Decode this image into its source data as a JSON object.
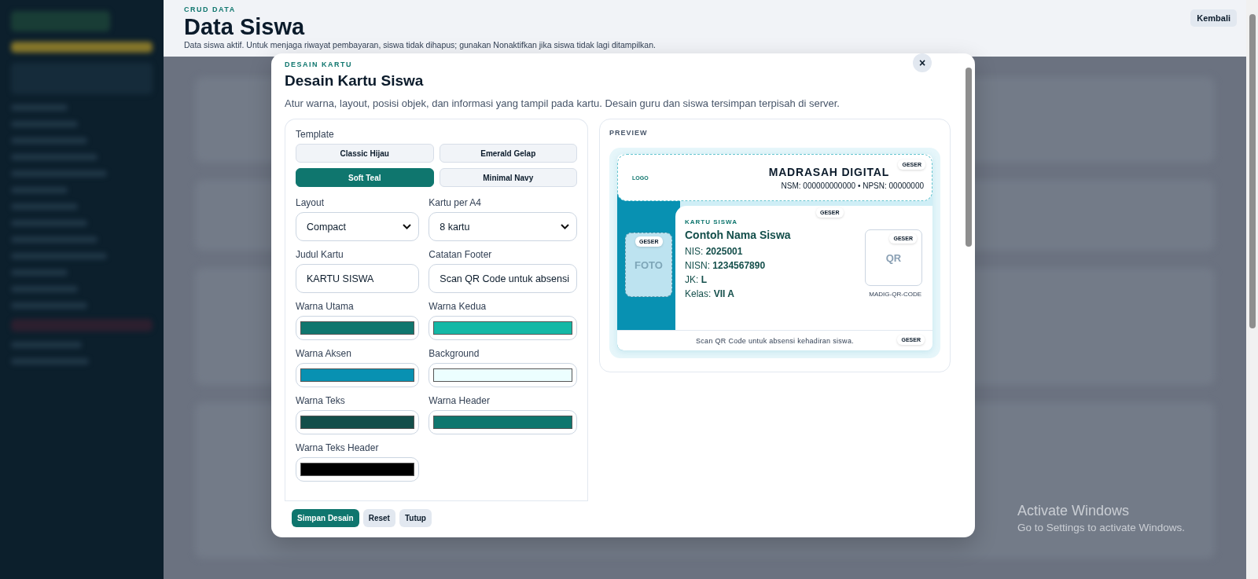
{
  "header": {
    "eyebrow": "CRUD DATA",
    "title": "Data Siswa",
    "description": "Data siswa aktif. Untuk menjaga riwayat pembayaran, siswa tidak dihapus; gunakan Nonaktifkan jika siswa tidak lagi ditampilkan.",
    "back_button": "Kembali"
  },
  "modal": {
    "eyebrow": "DESAIN KARTU",
    "title": "Desain Kartu Siswa",
    "description": "Atur warna, layout, posisi objek, dan informasi yang tampil pada kartu. Desain guru dan siswa tersimpan terpisah di server.",
    "close_label": "×",
    "template_label": "Template",
    "templates": [
      {
        "label": "Classic Hijau",
        "selected": false
      },
      {
        "label": "Emerald Gelap",
        "selected": false
      },
      {
        "label": "Soft Teal",
        "selected": true
      },
      {
        "label": "Minimal Navy",
        "selected": false
      }
    ],
    "fields": [
      {
        "kind": "select",
        "label": "Layout",
        "value": "Compact"
      },
      {
        "kind": "select",
        "label": "Kartu per A4",
        "value": "8 kartu"
      },
      {
        "kind": "text",
        "label": "Judul Kartu",
        "value": "KARTU SISWA"
      },
      {
        "kind": "text",
        "label": "Catatan Footer",
        "value": "Scan QR Code untuk absensi"
      },
      {
        "kind": "color",
        "label": "Warna Utama",
        "color": "#0f766e"
      },
      {
        "kind": "color",
        "label": "Warna Kedua",
        "color": "#14b8a6"
      },
      {
        "kind": "color",
        "label": "Warna Aksen",
        "color": "#0891b2"
      },
      {
        "kind": "color",
        "label": "Background",
        "color": "#ecfeff"
      },
      {
        "kind": "color",
        "label": "Warna Teks",
        "color": "#134e4a"
      },
      {
        "kind": "color",
        "label": "Warna Header",
        "color": "#0f766e"
      },
      {
        "kind": "color",
        "label": "Warna Teks Header",
        "color": "#000000"
      }
    ],
    "preview": {
      "label": "PREVIEW",
      "logo": "LOGO",
      "school": "MADRASAH DIGITAL",
      "ids": "NSM: 000000000000 • NPSN: 00000000",
      "drag_labels": [
        "GESER",
        "GESER",
        "GESER",
        "GESER",
        "GESER"
      ],
      "card_title": "KARTU SISWA",
      "student_name": "Contoh Nama Siswa",
      "details": [
        {
          "label": "NIS:",
          "value": "2025001"
        },
        {
          "label": "NISN:",
          "value": "1234567890"
        },
        {
          "label": "JK:",
          "value": "L"
        },
        {
          "label": "Kelas:",
          "value": "VII A"
        }
      ],
      "photo": "FOTO",
      "qr": "QR",
      "qr_caption": "MADIG-QR-CODE",
      "footer": "Scan QR Code untuk absensi kehadiran siswa."
    },
    "buttons": [
      {
        "label": "Simpan Desain",
        "kind": "primary"
      },
      {
        "label": "Reset",
        "kind": "secondary"
      },
      {
        "label": "Tutup",
        "kind": "secondary"
      }
    ]
  },
  "os_notice": {
    "title": "Activate Windows",
    "subtitle": "Go to Settings to activate Windows."
  }
}
